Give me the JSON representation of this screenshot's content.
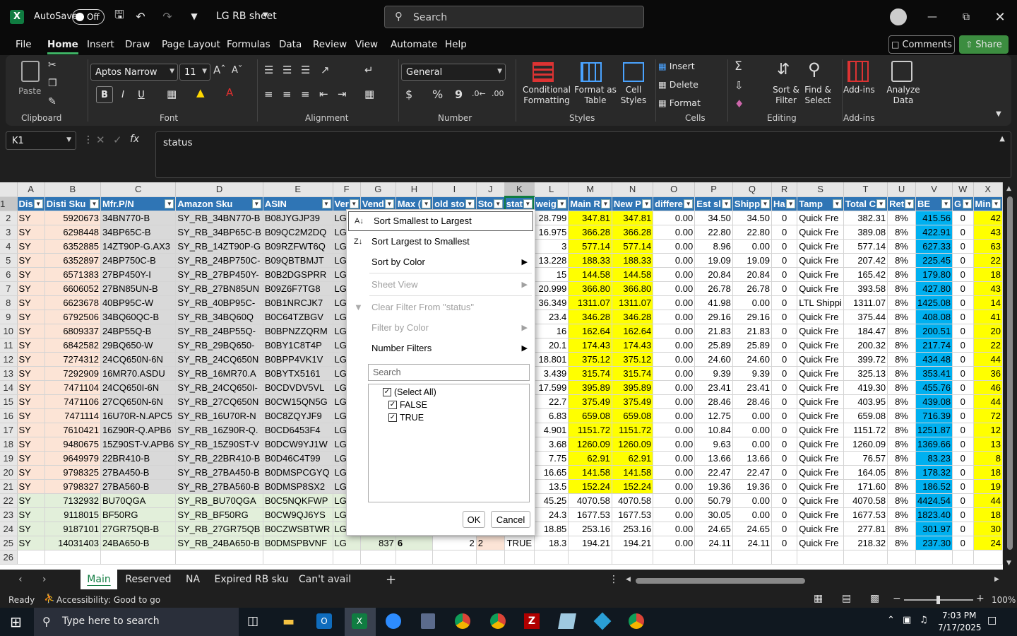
{
  "title": {
    "autosave": "AutoSave",
    "autosave_state": "Off",
    "filename": "LG RB sheet",
    "search_placeholder": "Search"
  },
  "menu": [
    "File",
    "Home",
    "Insert",
    "Draw",
    "Page Layout",
    "Formulas",
    "Data",
    "Review",
    "View",
    "Automate",
    "Help"
  ],
  "menu_active": "Home",
  "top_buttons": {
    "comments": "Comments",
    "share": "Share"
  },
  "ribbon": {
    "clipboard": {
      "paste": "Paste",
      "label": "Clipboard"
    },
    "font": {
      "name": "Aptos Narrow",
      "size": "11",
      "label": "Font",
      "bold": "B",
      "italic": "I",
      "underline": "U"
    },
    "alignment": {
      "label": "Alignment"
    },
    "number": {
      "format": "General",
      "label": "Number",
      "currency": "$",
      "percent": "%",
      "comma": "9"
    },
    "styles": {
      "cond1": "Conditional",
      "cond2": "Formatting",
      "fmt1": "Format as",
      "fmt2": "Table",
      "cell1": "Cell",
      "cell2": "Styles",
      "label": "Styles"
    },
    "cells": {
      "insert": "Insert",
      "delete": "Delete",
      "format": "Format",
      "label": "Cells"
    },
    "editing": {
      "sort1": "Sort &",
      "sort2": "Filter",
      "find1": "Find &",
      "find2": "Select",
      "label": "Editing"
    },
    "addins": {
      "addins": "Add-ins",
      "label": "Add-ins",
      "analyze1": "Analyze",
      "analyze2": "Data"
    }
  },
  "formula": {
    "namebox": "K1",
    "fx": "fx",
    "content": "status"
  },
  "columns": [
    "A",
    "B",
    "C",
    "D",
    "E",
    "F",
    "G",
    "H",
    "I",
    "J",
    "K",
    "L",
    "M",
    "N",
    "O",
    "P",
    "Q",
    "R",
    "S",
    "T",
    "U",
    "V",
    "W",
    "X"
  ],
  "headers": [
    "Dis",
    "Disti Sku",
    "Mfr.P/N",
    "Amazon Sku",
    "ASIN",
    "Ver",
    "Vend",
    "Max (",
    "old sto",
    "Sto",
    "stat",
    "weig",
    "Main R",
    "New P",
    "differe",
    "Est sl",
    "Shipp",
    "Ha",
    "Tamp",
    "Total C",
    "Ret",
    "BE",
    "G",
    "Min"
  ],
  "rows": [
    [
      "SY",
      "5920673",
      "34BN770-B",
      "SY_RB_34BN770-B",
      "B08JYGJP39",
      "LG",
      "",
      "",
      "",
      "",
      "",
      "28.799",
      "347.81",
      "347.81",
      "0.00",
      "34.50",
      "34.50",
      "0",
      "Quick Fre",
      "382.31",
      "8%",
      "415.56",
      "0",
      "42"
    ],
    [
      "SY",
      "6298448",
      "34BP65C-B",
      "SY_RB_34BP65C-B",
      "B09QC2M2DQ",
      "LG",
      "",
      "",
      "",
      "",
      "",
      "16.975",
      "366.28",
      "366.28",
      "0.00",
      "22.80",
      "22.80",
      "0",
      "Quick Fre",
      "389.08",
      "8%",
      "422.91",
      "0",
      "43"
    ],
    [
      "SY",
      "6352885",
      "14ZT90P-G.AX3",
      "SY_RB_14ZT90P-G",
      "B09RZFWT6Q",
      "LG",
      "",
      "",
      "",
      "",
      "",
      "3",
      "577.14",
      "577.14",
      "0.00",
      "8.96",
      "0.00",
      "0",
      "Quick Fre",
      "577.14",
      "8%",
      "627.33",
      "0",
      "63"
    ],
    [
      "SY",
      "6352897",
      "24BP750C-B",
      "SY_RB_24BP750C-",
      "B09QBTBMJT",
      "LG",
      "",
      "",
      "",
      "",
      "",
      "13.228",
      "188.33",
      "188.33",
      "0.00",
      "19.09",
      "19.09",
      "0",
      "Quick Fre",
      "207.42",
      "8%",
      "225.45",
      "0",
      "22"
    ],
    [
      "SY",
      "6571383",
      "27BP450Y-I",
      "SY_RB_27BP450Y-",
      "B0B2DGSPRR",
      "LG",
      "",
      "",
      "",
      "",
      "",
      "15",
      "144.58",
      "144.58",
      "0.00",
      "20.84",
      "20.84",
      "0",
      "Quick Fre",
      "165.42",
      "8%",
      "179.80",
      "0",
      "18"
    ],
    [
      "SY",
      "6606052",
      "27BN85UN-B",
      "SY_RB_27BN85UN",
      "B09Z6F7TG8",
      "LG",
      "",
      "",
      "",
      "",
      "",
      "20.999",
      "366.80",
      "366.80",
      "0.00",
      "26.78",
      "26.78",
      "0",
      "Quick Fre",
      "393.58",
      "8%",
      "427.80",
      "0",
      "43"
    ],
    [
      "SY",
      "6623678",
      "40BP95C-W",
      "SY_RB_40BP95C-",
      "B0B1NRCJK7",
      "LG",
      "",
      "",
      "",
      "",
      "",
      "36.349",
      "1311.07",
      "1311.07",
      "0.00",
      "41.98",
      "0.00",
      "0",
      "LTL Shippi",
      "1311.07",
      "8%",
      "1425.08",
      "0",
      "14"
    ],
    [
      "SY",
      "6792506",
      "34BQ60QC-B",
      "SY_RB_34BQ60Q",
      "B0C64TZBGV",
      "LG",
      "",
      "",
      "",
      "",
      "",
      "23.4",
      "346.28",
      "346.28",
      "0.00",
      "29.16",
      "29.16",
      "0",
      "Quick Fre",
      "375.44",
      "8%",
      "408.08",
      "0",
      "41"
    ],
    [
      "SY",
      "6809337",
      "24BP55Q-B",
      "SY_RB_24BP55Q-",
      "B0BPNZZQRM",
      "LG",
      "",
      "",
      "",
      "",
      "",
      "16",
      "162.64",
      "162.64",
      "0.00",
      "21.83",
      "21.83",
      "0",
      "Quick Fre",
      "184.47",
      "8%",
      "200.51",
      "0",
      "20"
    ],
    [
      "SY",
      "6842582",
      "29BQ650-W",
      "SY_RB_29BQ650-",
      "B0BY1C8T4P",
      "LG",
      "",
      "",
      "",
      "",
      "",
      "20.1",
      "174.43",
      "174.43",
      "0.00",
      "25.89",
      "25.89",
      "0",
      "Quick Fre",
      "200.32",
      "8%",
      "217.74",
      "0",
      "22"
    ],
    [
      "SY",
      "7274312",
      "24CQ650N-6N",
      "SY_RB_24CQ650N",
      "B0BPP4VK1V",
      "LG",
      "",
      "",
      "",
      "",
      "",
      "18.801",
      "375.12",
      "375.12",
      "0.00",
      "24.60",
      "24.60",
      "0",
      "Quick Fre",
      "399.72",
      "8%",
      "434.48",
      "0",
      "44"
    ],
    [
      "SY",
      "7292909",
      "16MR70.ASDU",
      "SY_RB_16MR70.A",
      "B0BYTX5161",
      "LG",
      "",
      "",
      "",
      "",
      "",
      "3.439",
      "315.74",
      "315.74",
      "0.00",
      "9.39",
      "9.39",
      "0",
      "Quick Fre",
      "325.13",
      "8%",
      "353.41",
      "0",
      "36"
    ],
    [
      "SY",
      "7471104",
      "24CQ650I-6N",
      "SY_RB_24CQ650I-",
      "B0CDVDV5VL",
      "LG",
      "",
      "",
      "",
      "",
      "",
      "17.599",
      "395.89",
      "395.89",
      "0.00",
      "23.41",
      "23.41",
      "0",
      "Quick Fre",
      "419.30",
      "8%",
      "455.76",
      "0",
      "46"
    ],
    [
      "SY",
      "7471106",
      "27CQ650N-6N",
      "SY_RB_27CQ650N",
      "B0CW15QN5G",
      "LG",
      "",
      "",
      "",
      "",
      "",
      "22.7",
      "375.49",
      "375.49",
      "0.00",
      "28.46",
      "28.46",
      "0",
      "Quick Fre",
      "403.95",
      "8%",
      "439.08",
      "0",
      "44"
    ],
    [
      "SY",
      "7471114",
      "16U70R-N.APC5",
      "SY_RB_16U70R-N",
      "B0C8ZQYJF9",
      "LG",
      "",
      "",
      "",
      "",
      "",
      "6.83",
      "659.08",
      "659.08",
      "0.00",
      "12.75",
      "0.00",
      "0",
      "Quick Fre",
      "659.08",
      "8%",
      "716.39",
      "0",
      "72"
    ],
    [
      "SY",
      "7610421",
      "16Z90R-Q.APB6",
      "SY_RB_16Z90R-Q.",
      "B0CD6453F4",
      "LG",
      "",
      "",
      "",
      "",
      "",
      "4.901",
      "1151.72",
      "1151.72",
      "0.00",
      "10.84",
      "0.00",
      "0",
      "Quick Fre",
      "1151.72",
      "8%",
      "1251.87",
      "0",
      "12"
    ],
    [
      "SY",
      "9480675",
      "15Z90ST-V.APB6",
      "SY_RB_15Z90ST-V",
      "B0DCW9YJ1W",
      "LG",
      "",
      "",
      "",
      "",
      "",
      "3.68",
      "1260.09",
      "1260.09",
      "0.00",
      "9.63",
      "0.00",
      "0",
      "Quick Fre",
      "1260.09",
      "8%",
      "1369.66",
      "0",
      "13"
    ],
    [
      "SY",
      "9649979",
      "22BR410-B",
      "SY_RB_22BR410-B",
      "B0D46C4T99",
      "LG",
      "",
      "",
      "",
      "",
      "",
      "7.75",
      "62.91",
      "62.91",
      "0.00",
      "13.66",
      "13.66",
      "0",
      "Quick Fre",
      "76.57",
      "8%",
      "83.23",
      "0",
      "8"
    ],
    [
      "SY",
      "9798325",
      "27BA450-B",
      "SY_RB_27BA450-B",
      "B0DMSPCGYQ",
      "LG",
      "",
      "",
      "",
      "",
      "",
      "16.65",
      "141.58",
      "141.58",
      "0.00",
      "22.47",
      "22.47",
      "0",
      "Quick Fre",
      "164.05",
      "8%",
      "178.32",
      "0",
      "18"
    ],
    [
      "SY",
      "9798327",
      "27BA560-B",
      "SY_RB_27BA560-B",
      "B0DMSP8SX2",
      "LG",
      "",
      "",
      "",
      "",
      "",
      "13.5",
      "152.24",
      "152.24",
      "0.00",
      "19.36",
      "19.36",
      "0",
      "Quick Fre",
      "171.60",
      "8%",
      "186.52",
      "0",
      "19"
    ],
    [
      "SY",
      "7132932",
      "BU70QGA",
      "SY_RB_BU70QGA",
      "B0C5NQKFWP",
      "LG",
      "",
      "",
      "",
      "",
      "",
      "45.25",
      "4070.58",
      "4070.58",
      "0.00",
      "50.79",
      "0.00",
      "0",
      "Quick Fre",
      "4070.58",
      "8%",
      "4424.54",
      "0",
      "44"
    ],
    [
      "SY",
      "9118015",
      "BF50RG",
      "SY_RB_BF50RG",
      "B0CW9QJ6YS",
      "LG",
      "",
      "",
      "",
      "",
      "",
      "24.3",
      "1677.53",
      "1677.53",
      "0.00",
      "30.05",
      "0.00",
      "0",
      "Quick Fre",
      "1677.53",
      "8%",
      "1823.40",
      "0",
      "18"
    ],
    [
      "SY",
      "9187101",
      "27GR75QB-B",
      "SY_RB_27GR75QB",
      "B0CZWSBTWR",
      "LG",
      "",
      "",
      "",
      "",
      "",
      "18.85",
      "253.16",
      "253.16",
      "0.00",
      "24.65",
      "24.65",
      "0",
      "Quick Fre",
      "277.81",
      "8%",
      "301.97",
      "0",
      "30"
    ],
    [
      "SY",
      "14031403",
      "24BA650-B",
      "SY_RB_24BA650-B",
      "B0DMSPBVNF",
      "LG",
      "837",
      "6",
      "2",
      "2",
      "TRUE",
      "18.3",
      "194.21",
      "194.21",
      "0.00",
      "24.11",
      "24.11",
      "0",
      "Quick Fre",
      "218.32",
      "8%",
      "237.30",
      "0",
      "24"
    ]
  ],
  "filter_menu": {
    "sort_asc": "Sort Smallest to Largest",
    "sort_desc": "Sort Largest to Smallest",
    "sort_color": "Sort by Color",
    "sheet_view": "Sheet View",
    "clear_filter": "Clear Filter From \"status\"",
    "filter_color": "Filter by Color",
    "number_filters": "Number Filters",
    "search_placeholder": "Search",
    "options": [
      "(Select All)",
      "FALSE",
      "TRUE"
    ],
    "ok": "OK",
    "cancel": "Cancel"
  },
  "sheets": [
    "Main",
    "Reserved",
    "NA",
    "Expired RB sku",
    "Can't avail"
  ],
  "active_sheet": "Main",
  "statusbar": {
    "ready": "Ready",
    "accessibility": "Accessibility: Good to go",
    "zoom": "100%"
  },
  "taskbar": {
    "search_placeholder": "Type here to search",
    "time": "7:03 PM",
    "date": "7/17/2025"
  },
  "colors": {
    "header_blue": "#2f75b5",
    "salmon": "#fce4d6",
    "yellow": "#ffff00",
    "cyan": "#00b0f0",
    "green_light": "#e2efda",
    "gray": "#d9d9d9",
    "share_green": "#3c8d40"
  }
}
